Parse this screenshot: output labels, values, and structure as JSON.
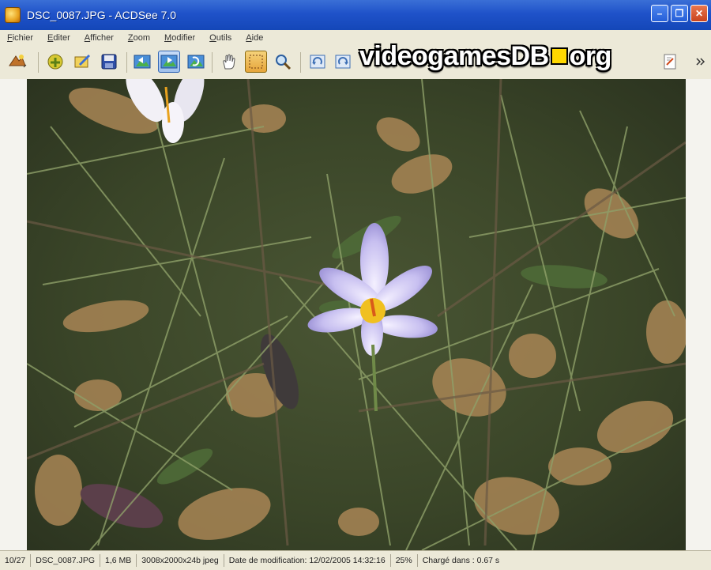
{
  "window": {
    "title": "DSC_0087.JPG - ACDSee 7.0",
    "minimize": "–",
    "maximize": "❐",
    "close": "✕"
  },
  "menu": [
    "Fichier",
    "Editer",
    "Afficher",
    "Zoom",
    "Modifier",
    "Outils",
    "Aide"
  ],
  "toolbar": {
    "icons": [
      "browse-icon",
      "open-folder-icon",
      "edit-icon",
      "save-icon",
      "previous-image-icon",
      "next-image-icon",
      "rotate-icon",
      "hand-tool-icon",
      "select-tool-icon",
      "zoom-tool-icon",
      "rotate-left-icon",
      "rotate-right-icon",
      "properties-icon",
      "more-icon"
    ],
    "active": "next-image-icon"
  },
  "watermark": {
    "left": "videogamesDB",
    "right": "org"
  },
  "status": {
    "position": "10/27",
    "filename": "DSC_0087.JPG",
    "filesize": "1,6 MB",
    "dimensions": "3008x2000x24b jpeg",
    "modified": "Date de modification: 12/02/2005 14:32:16",
    "zoom": "25%",
    "load_time": "Chargé dans : 0.67 s"
  },
  "colors": {
    "titlebar": "#1f52c9",
    "flower_petal": "#c9c3f0",
    "flower_center": "#f0c020",
    "grass": "#3b4a2a"
  }
}
